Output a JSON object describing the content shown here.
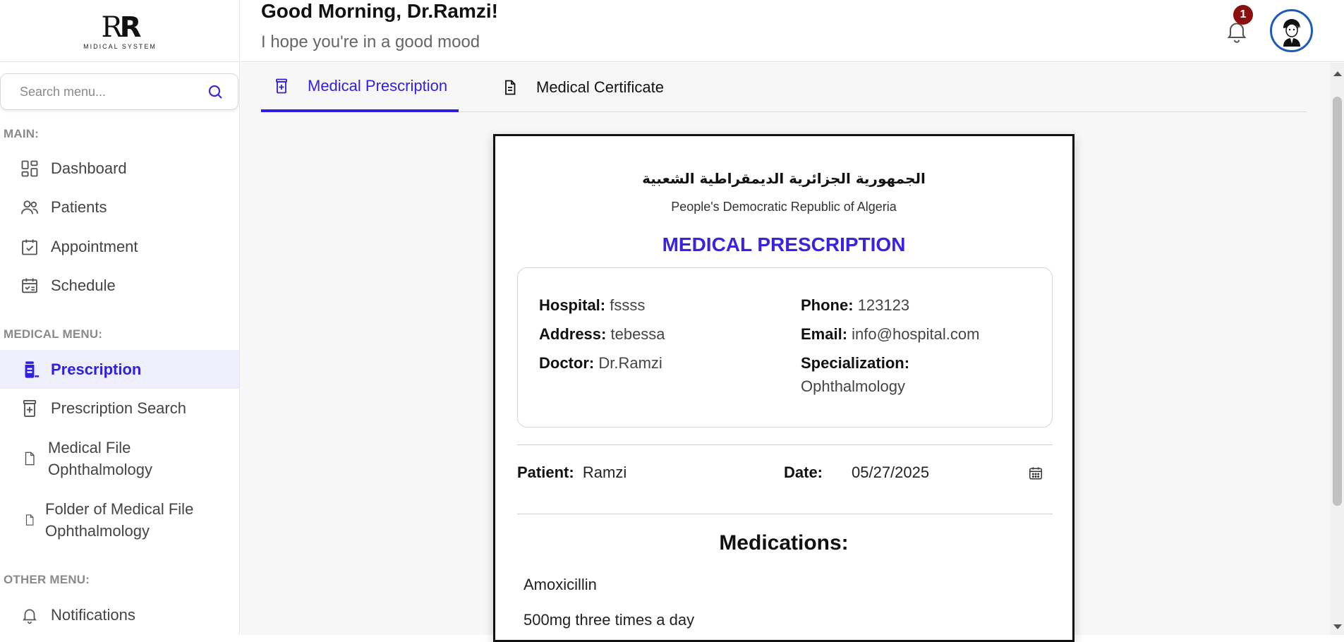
{
  "logo": {
    "mark_left": "R",
    "mark_right": "R",
    "subtitle": "MIDICAL SYSTEM"
  },
  "search": {
    "placeholder": "Search menu..."
  },
  "sidebar": {
    "main_label": "MAIN:",
    "main_items": [
      {
        "label": "Dashboard",
        "icon": "dashboard-icon"
      },
      {
        "label": "Patients",
        "icon": "patients-icon"
      },
      {
        "label": "Appointment",
        "icon": "appointment-icon"
      },
      {
        "label": "Schedule",
        "icon": "schedule-icon"
      }
    ],
    "medical_label": "MEDICAL MENU:",
    "medical_items": [
      {
        "label": "Prescription",
        "icon": "pill-bottle-icon",
        "active": true
      },
      {
        "label": "Prescription Search",
        "icon": "prescription-search-icon"
      },
      {
        "label": "Medical File Ophthalmology",
        "line1": "Medical File",
        "line2": "Ophthalmology",
        "icon": "file-icon"
      },
      {
        "label": "Folder of Medical File Ophthalmology",
        "line1": "Folder of Medical File",
        "line2": "Ophthalmology",
        "icon": "file-icon"
      }
    ],
    "other_label": "OTHER MENU:",
    "other_items": [
      {
        "label": "Notifications",
        "icon": "bell-icon"
      }
    ]
  },
  "header": {
    "greeting": "Good Morning, Dr.Ramzi!",
    "subtitle": "I hope you're in a good mood",
    "notification_count": "1"
  },
  "tabs": [
    {
      "label": "Medical Prescription",
      "icon": "prescription-icon",
      "active": true
    },
    {
      "label": "Medical Certificate",
      "icon": "document-icon",
      "active": false
    }
  ],
  "prescription": {
    "arabic_header": "الجمهورية الجزائرية الديمقراطية الشعبية",
    "country": "People's Democratic Republic of Algeria",
    "title": "MEDICAL PRESCRIPTION",
    "hospital_label": "Hospital:",
    "hospital": "fssss",
    "address_label": "Address:",
    "address": "tebessa",
    "doctor_label": "Doctor:",
    "doctor": "Dr.Ramzi",
    "phone_label": "Phone:",
    "phone": "123123",
    "email_label": "Email:",
    "email": "info@hospital.com",
    "specialization_label": "Specialization:",
    "specialization": "Ophthalmology",
    "patient_label": "Patient:",
    "patient": "Ramzi",
    "date_label": "Date:",
    "date": "05/27/2025",
    "medications_title": "Medications:",
    "medications": [
      {
        "name": "Amoxicillin",
        "dosage": "500mg three times a day"
      }
    ]
  },
  "colors": {
    "accent": "#2f1fe0",
    "badge": "#8b0f0f",
    "avatar_ring": "#1e5bb8",
    "active_bg": "#efeefc"
  }
}
